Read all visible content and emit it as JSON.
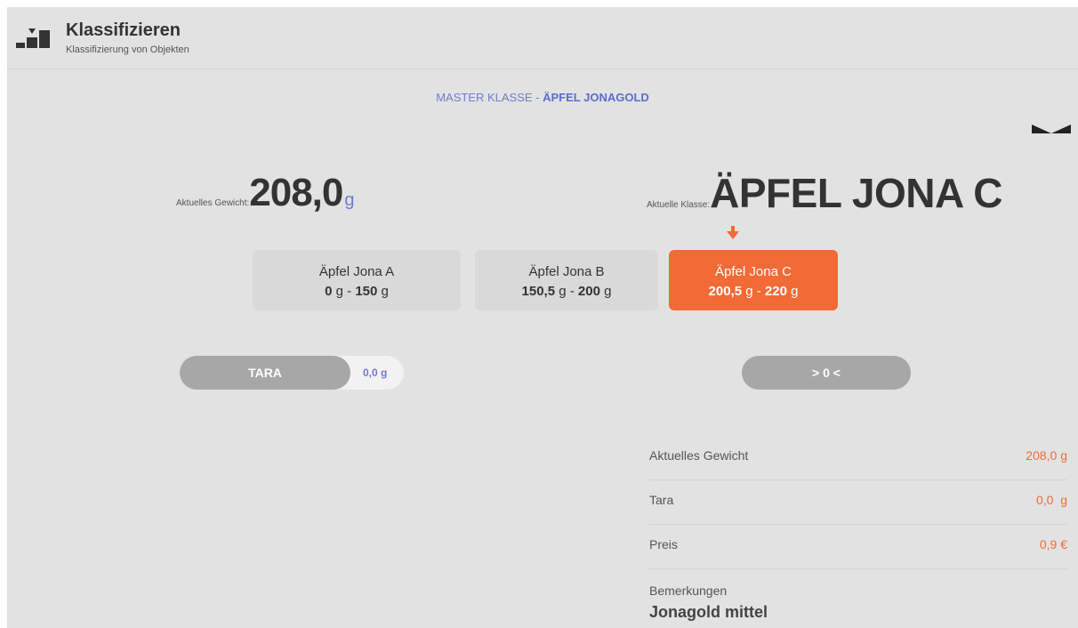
{
  "header": {
    "title": "Klassifizieren",
    "subtitle": "Klassifizierung von Objekten",
    "icon": "bar-classify-icon"
  },
  "master": {
    "label": "MASTER KLASSE",
    "separator": " - ",
    "name": "ÄPFEL JONAGOLD"
  },
  "current_weight": {
    "label": "Aktuelles Gewicht:",
    "value": "208,0",
    "unit": "g"
  },
  "current_class": {
    "label": "Aktuelle Klasse:",
    "value": "ÄPFEL JONA C"
  },
  "classes": [
    {
      "name": "Äpfel Jona A",
      "min": "0",
      "max": "150",
      "unit": "g",
      "active": false
    },
    {
      "name": "Äpfel Jona B",
      "min": "150,5",
      "max": "200",
      "unit": "g",
      "active": false
    },
    {
      "name": "Äpfel Jona C",
      "min": "200,5",
      "max": "220",
      "unit": "g",
      "active": true
    }
  ],
  "range_separator": "-",
  "tara": {
    "button_label": "TARA",
    "value": "0,0",
    "unit": "g"
  },
  "zero_button_label": "> 0 <",
  "info": {
    "rows": [
      {
        "label": "Aktuelles Gewicht",
        "value": "208,0 g"
      },
      {
        "label": "Tara",
        "value": "0,0  g"
      },
      {
        "label": "Preis",
        "value": "0,9 €"
      }
    ],
    "remarks_label": "Bemerkungen",
    "remarks_value": "Jonagold mittel"
  },
  "colors": {
    "accent": "#f26a35",
    "link": "#6f7bd0",
    "background": "#e2e2e2",
    "button_gray": "#a7a7a7"
  }
}
